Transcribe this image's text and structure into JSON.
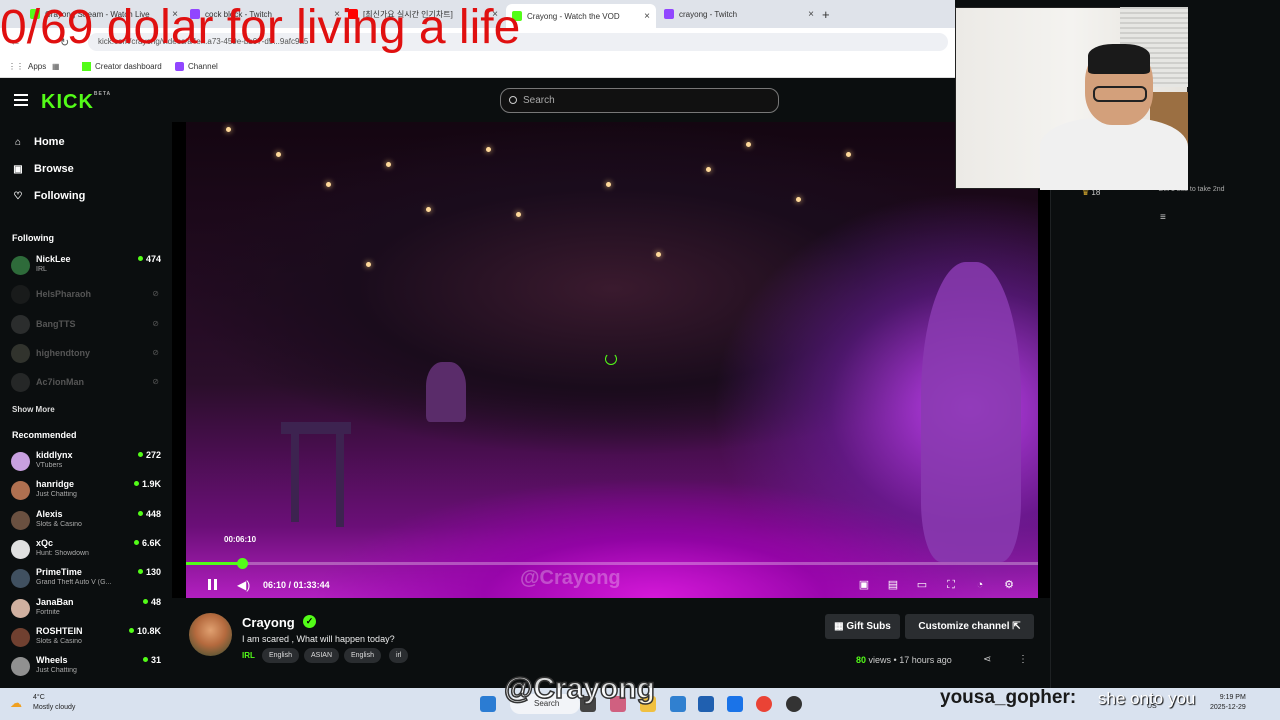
{
  "browser": {
    "tabs": [
      {
        "label": "Crayong Stream - Watch Live",
        "color": "#53fc18"
      },
      {
        "label": "cock block - Twitch",
        "color": "#9146ff"
      },
      {
        "label": "[최신가요 실시간 인기차트]",
        "color": "#ff0000"
      },
      {
        "label": "Crayong - Watch the VOD",
        "color": "#53fc18"
      },
      {
        "label": "crayong - Twitch",
        "color": "#9146ff"
      }
    ],
    "url": "kick.com/crayong/videos/a4e...a73-459e-bb07-d5...9afc9a5",
    "bookmarks": [
      "Apps",
      "Creator dashboard",
      "Channel"
    ]
  },
  "overlay_title": "0/69 dolar for living a life",
  "kick": {
    "logo": "KICK",
    "logo_sup": "BETA",
    "search_placeholder": "Search",
    "nav": [
      {
        "label": "Home",
        "icon": "⌂"
      },
      {
        "label": "Browse",
        "icon": "▣"
      },
      {
        "label": "Following",
        "icon": "♡"
      }
    ],
    "following_header": "Following",
    "following": [
      {
        "name": "NickLee",
        "category": "IRL",
        "viewers": "474",
        "live": true,
        "avatar": "#2e6b3a"
      },
      {
        "name": "HelsPharaoh",
        "category": "",
        "viewers": "",
        "live": false,
        "avatar": "#333"
      },
      {
        "name": "BangTTS",
        "category": "",
        "viewers": "",
        "live": false,
        "avatar": "#666"
      },
      {
        "name": "highendtony",
        "category": "",
        "viewers": "",
        "live": false,
        "avatar": "#776"
      },
      {
        "name": "Ac7ionMan",
        "category": "",
        "viewers": "",
        "live": false,
        "avatar": "#555"
      }
    ],
    "show_more": "Show More",
    "recommended_header": "Recommended",
    "recommended": [
      {
        "name": "kiddlynx",
        "category": "VTubers",
        "viewers": "272",
        "avatar": "#c8a0e0"
      },
      {
        "name": "hanridge",
        "category": "Just Chatting",
        "viewers": "1.9K",
        "avatar": "#b07050"
      },
      {
        "name": "Alexis",
        "category": "Slots & Casino",
        "viewers": "448",
        "avatar": "#6a5040"
      },
      {
        "name": "xQc",
        "category": "Hunt: Showdown",
        "viewers": "6.6K",
        "avatar": "#e0e0e0"
      },
      {
        "name": "PrimeTime",
        "category": "Grand Theft Auto V (G...",
        "viewers": "130",
        "avatar": "#405060"
      },
      {
        "name": "JanaBan",
        "category": "Fortnite",
        "viewers": "48",
        "avatar": "#d0b0a0"
      },
      {
        "name": "ROSHTEIN",
        "category": "Slots & Casino",
        "viewers": "10.8K",
        "avatar": "#704030"
      },
      {
        "name": "Wheels",
        "category": "Just Chatting",
        "viewers": "31",
        "avatar": "#909090"
      }
    ]
  },
  "player": {
    "tooltip_time": "00:06:10",
    "current_time": "06:10",
    "duration": "01:33:44",
    "progress_fraction": 0.0658,
    "watermark": "@Crayong",
    "icons": [
      "miniplayer-icon",
      "theater-icon",
      "cinema-icon",
      "fullscreen-icon",
      "speed-icon",
      "settings-icon"
    ]
  },
  "channel": {
    "name": "Crayong",
    "stream_title": "I am scared , What will happen today?",
    "category": "IRL",
    "tags": [
      "English",
      "ASIAN",
      "English",
      "irl"
    ],
    "gift_label": "Gift Subs",
    "customize_label": "Customize channel",
    "views_count": "80",
    "views_word": "views",
    "age": "17 hours ago"
  },
  "chat": {
    "sub_msg": "Gift 1 sub to take 2nd",
    "gift_count": "18"
  },
  "taskbar": {
    "weather_temp": "4°C",
    "weather_desc": "Mostly cloudy",
    "search_label": "Search",
    "time": "9:19 PM",
    "date": "2025-12-29",
    "lang": "US"
  },
  "stream_overlay": {
    "watermark": "@Crayong",
    "chat_user": "yousa_gopher:",
    "chat_message": "she onto you"
  }
}
